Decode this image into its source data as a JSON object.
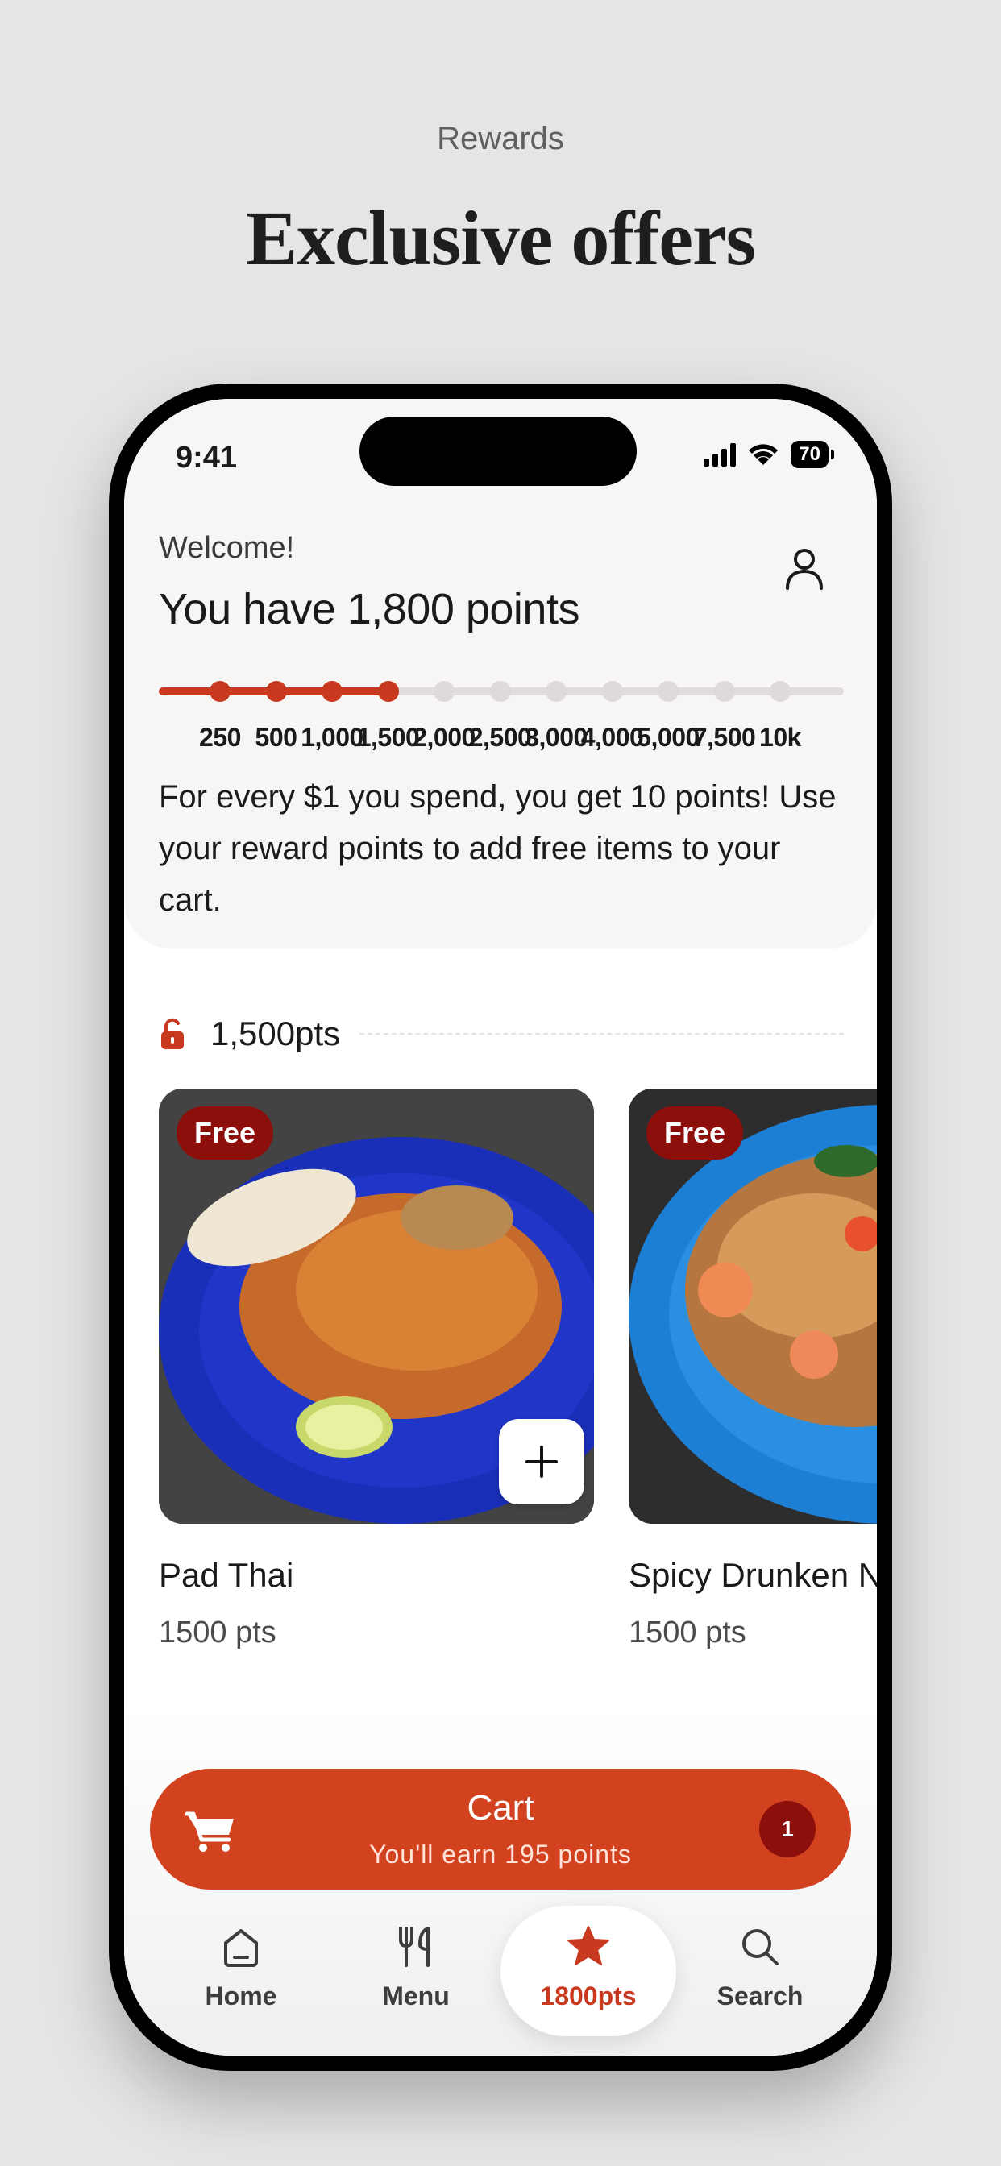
{
  "page": {
    "kicker": "Rewards",
    "title": "Exclusive offers"
  },
  "status_bar": {
    "time": "9:41",
    "battery": "70"
  },
  "header": {
    "welcome": "Welcome!",
    "points_title": "You have 1,800 points",
    "progress": {
      "current_points": 1800,
      "milestones": [
        {
          "label": "250",
          "value": 250,
          "reached": true
        },
        {
          "label": "500",
          "value": 500,
          "reached": true
        },
        {
          "label": "1,000",
          "value": 1000,
          "reached": true
        },
        {
          "label": "1,500",
          "value": 1500,
          "reached": true
        },
        {
          "label": "2,000",
          "value": 2000,
          "reached": false
        },
        {
          "label": "2,500",
          "value": 2500,
          "reached": false
        },
        {
          "label": "3,000",
          "value": 3000,
          "reached": false
        },
        {
          "label": "4,000",
          "value": 4000,
          "reached": false
        },
        {
          "label": "5,000",
          "value": 5000,
          "reached": false
        },
        {
          "label": "7,500",
          "value": 7500,
          "reached": false
        },
        {
          "label": "10k",
          "value": 10000,
          "reached": false
        }
      ]
    },
    "description": "For every $1 you spend, you get 10 points! Use your reward points to add free items to your cart.",
    "profile_icon": "user-icon"
  },
  "tier": {
    "label": "1,500pts",
    "icon": "unlocked-lock-icon"
  },
  "items": [
    {
      "name": "Pad Thai",
      "points": "1500 pts",
      "badge": "Free",
      "add_icon": "plus-icon"
    },
    {
      "name": "Spicy Drunken Noodles",
      "points": "1500 pts",
      "badge": "Free"
    }
  ],
  "cart": {
    "title": "Cart",
    "subtitle": "You'll earn 195 points",
    "count": "1",
    "icon": "cart-icon"
  },
  "tabs": [
    {
      "label": "Home",
      "icon": "home-icon",
      "active": false
    },
    {
      "label": "Menu",
      "icon": "fork-knife-icon",
      "active": false
    },
    {
      "label": "1800pts",
      "icon": "star-icon",
      "active": true
    },
    {
      "label": "Search",
      "icon": "search-icon",
      "active": false
    }
  ],
  "colors": {
    "accent": "#c8391f",
    "cart": "#d2421f",
    "badge": "#8c0f0c",
    "header_bg": "#f7f6f4",
    "page_bg": "#e5e5e5"
  }
}
